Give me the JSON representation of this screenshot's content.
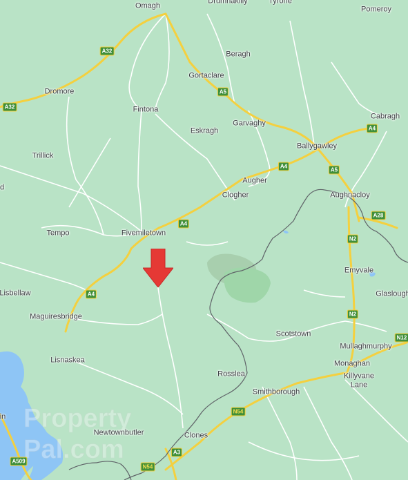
{
  "map": {
    "colors": {
      "land": "#b9e3c6",
      "road_minor": "#ffffff",
      "road_major": "#f4d03f",
      "border": "#5f6368",
      "water": "#8ec5f5",
      "park": "#9fd6a9",
      "marker": "#e53935"
    },
    "places": [
      {
        "id": "omagh",
        "name": "Omagh"
      },
      {
        "id": "drumnakilly",
        "name": "Drumnakilly"
      },
      {
        "id": "tyrone",
        "name": "Tyrone"
      },
      {
        "id": "pomeroy",
        "name": "Pomeroy"
      },
      {
        "id": "beragh",
        "name": "Beragh"
      },
      {
        "id": "gortaclare",
        "name": "Gortaclare"
      },
      {
        "id": "dromore",
        "name": "Dromore"
      },
      {
        "id": "fintona",
        "name": "Fintona"
      },
      {
        "id": "eskragh",
        "name": "Eskragh"
      },
      {
        "id": "garvaghy",
        "name": "Garvaghy"
      },
      {
        "id": "cabragh",
        "name": "Cabragh"
      },
      {
        "id": "ballygawley",
        "name": "Ballygawley"
      },
      {
        "id": "trillick",
        "name": "Trillick"
      },
      {
        "id": "augher",
        "name": "Augher"
      },
      {
        "id": "clogher",
        "name": "Clogher"
      },
      {
        "id": "aughnacloy",
        "name": "Aughnacloy"
      },
      {
        "id": "tempo",
        "name": "Tempo"
      },
      {
        "id": "fivemiletown",
        "name": "Fivemiletown"
      },
      {
        "id": "emyvale",
        "name": "Emyvale"
      },
      {
        "id": "lisbellaw",
        "name": "Lisbellaw"
      },
      {
        "id": "glaslough",
        "name": "Glaslough"
      },
      {
        "id": "maguiresbridge",
        "name": "Maguiresbridge"
      },
      {
        "id": "scotstown",
        "name": "Scotstown"
      },
      {
        "id": "mullaghmurphy",
        "name": "Mullaghmurphy"
      },
      {
        "id": "lisnaskea",
        "name": "Lisnaskea"
      },
      {
        "id": "monaghan",
        "name": "Monaghan"
      },
      {
        "id": "rosslea",
        "name": "Rosslea"
      },
      {
        "id": "killyvane_lane",
        "name": "Killyvane\nLane"
      },
      {
        "id": "smithborough",
        "name": "Smithborough"
      },
      {
        "id": "newtownbutler",
        "name": "Newtownbutler"
      },
      {
        "id": "clones",
        "name": "Clones"
      },
      {
        "id": "in",
        "name": "in"
      },
      {
        "id": "d",
        "name": "d"
      }
    ],
    "road_shields": [
      {
        "id": "a32_top",
        "label": "A32"
      },
      {
        "id": "a32_left",
        "label": "A32"
      },
      {
        "id": "a5_gortaclare",
        "label": "A5"
      },
      {
        "id": "a4_cabragh",
        "label": "A4"
      },
      {
        "id": "a4_augher",
        "label": "A4"
      },
      {
        "id": "a5_ballygawley",
        "label": "A5"
      },
      {
        "id": "a4_fivemiletown",
        "label": "A4"
      },
      {
        "id": "a28",
        "label": "A28"
      },
      {
        "id": "n2_upper",
        "label": "N2"
      },
      {
        "id": "a4_maguiresbridge",
        "label": "A4"
      },
      {
        "id": "n2_lower",
        "label": "N2"
      },
      {
        "id": "n12",
        "label": "N12"
      },
      {
        "id": "n54_smithborough",
        "label": "N54"
      },
      {
        "id": "a3",
        "label": "A3"
      },
      {
        "id": "n54_bottom",
        "label": "N54"
      },
      {
        "id": "a509",
        "label": "A509"
      }
    ],
    "marker": {
      "icon": "location-arrow-icon"
    },
    "watermark": {
      "text": "PropertyPal.com"
    }
  }
}
